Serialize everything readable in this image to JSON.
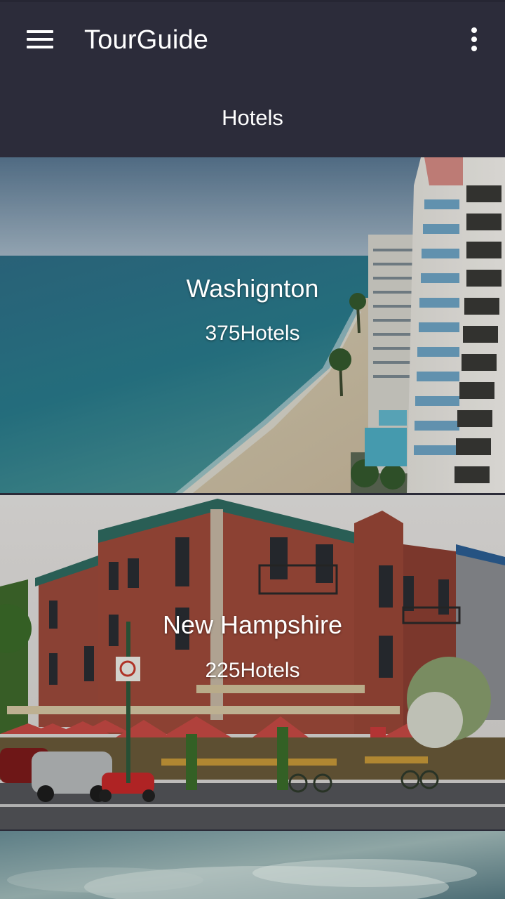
{
  "toolbar": {
    "title": "TourGuide",
    "menu_icon": "hamburger-menu-icon",
    "overflow_icon": "more-vertical-icon"
  },
  "section": {
    "title": "Hotels"
  },
  "destinations": [
    {
      "name": "Washignton",
      "count": "375Hotels"
    },
    {
      "name": "New Hampshire",
      "count": "225Hotels"
    }
  ],
  "colors": {
    "toolbar_bg": "#2c2c3a",
    "text": "#ffffff"
  }
}
